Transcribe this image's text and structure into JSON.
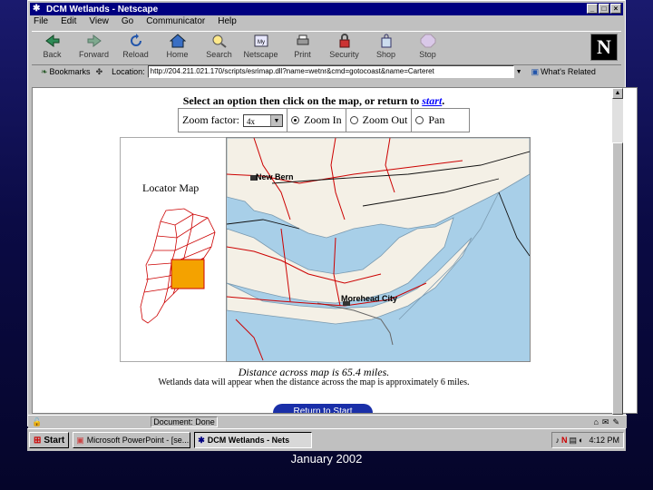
{
  "window": {
    "title": "DCM Wetlands - Netscape"
  },
  "menu": [
    "File",
    "Edit",
    "View",
    "Go",
    "Communicator",
    "Help"
  ],
  "toolbar": [
    "Back",
    "Forward",
    "Reload",
    "Home",
    "Search",
    "Netscape",
    "Print",
    "Security",
    "Shop",
    "Stop"
  ],
  "location": {
    "bookmarks_label": "Bookmarks",
    "label": "Location:",
    "url": "http://204.211.021.170/scripts/esrimap.dll?name=wetnr&cmd=gotocoast&name=Carteret",
    "related_label": "What's Related"
  },
  "page": {
    "heading_text": "Select an option then click on the map, or return to",
    "heading_link": "start",
    "heading_end": ".",
    "zoom_label": "Zoom factor:",
    "zoom_value": "4x",
    "options": [
      "Zoom In",
      "Zoom Out",
      "Pan"
    ],
    "selected_option": "Zoom In",
    "locator_title": "Locator Map",
    "map_labels": [
      "New Bern",
      "Morehead City"
    ],
    "distance": "Distance across map is 65.4 miles.",
    "note": "Wetlands data will appear when the distance across the map is approximately 6 miles.",
    "return_button": "Return to Start"
  },
  "status": {
    "text": "Document: Done"
  },
  "taskbar": {
    "start": "Start",
    "tasks": [
      "Microsoft PowerPoint - [se...",
      "DCM Wetlands - Nets"
    ],
    "active_task": "DCM Wetlands - Nets",
    "clock": "4:12 PM"
  },
  "caption": "January 2002",
  "colors": {
    "title_bar": "#000080",
    "map_water": "#a8cfe8",
    "map_land": "#f4f0e6",
    "roads": "#cc0000",
    "link": "#0000ff"
  }
}
